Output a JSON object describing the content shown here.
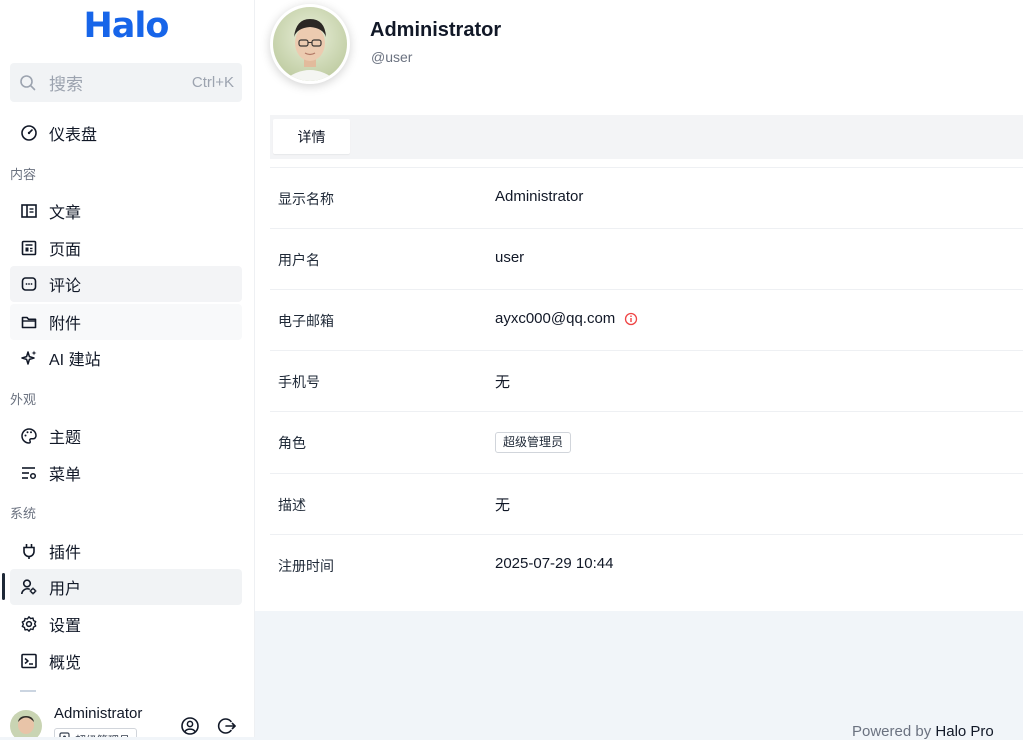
{
  "sidebar": {
    "logo": "Halo",
    "search": {
      "placeholder": "搜索",
      "shortcut": "Ctrl+K"
    },
    "dashboard": "仪表盘",
    "groups": {
      "content": "内容",
      "appearance": "外观",
      "system": "系统"
    },
    "items": {
      "posts": "文章",
      "pages": "页面",
      "comments": "评论",
      "attachments": "附件",
      "ai_site": "AI 建站",
      "themes": "主题",
      "menus": "菜单",
      "plugins": "插件",
      "users": "用户",
      "settings": "设置",
      "overview": "概览"
    },
    "profile": {
      "name": "Administrator",
      "role": "超级管理员"
    }
  },
  "user": {
    "display_name": "Administrator",
    "username": "@user"
  },
  "tabs": {
    "details": "详情"
  },
  "details": {
    "display_name": {
      "label": "显示名称",
      "value": "Administrator"
    },
    "username": {
      "label": "用户名",
      "value": "user"
    },
    "email": {
      "label": "电子邮箱",
      "value": "ayxc000@qq.com"
    },
    "phone": {
      "label": "手机号",
      "value": "无"
    },
    "role": {
      "label": "角色",
      "value": "超级管理员"
    },
    "description": {
      "label": "描述",
      "value": "无"
    },
    "registered": {
      "label": "注册时间",
      "value": "2025-07-29 10:44"
    }
  },
  "footer": {
    "prefix": "Powered by",
    "brand": "Halo Pro"
  },
  "colors": {
    "brand": "#1765e9",
    "warning": "#ef4444"
  }
}
